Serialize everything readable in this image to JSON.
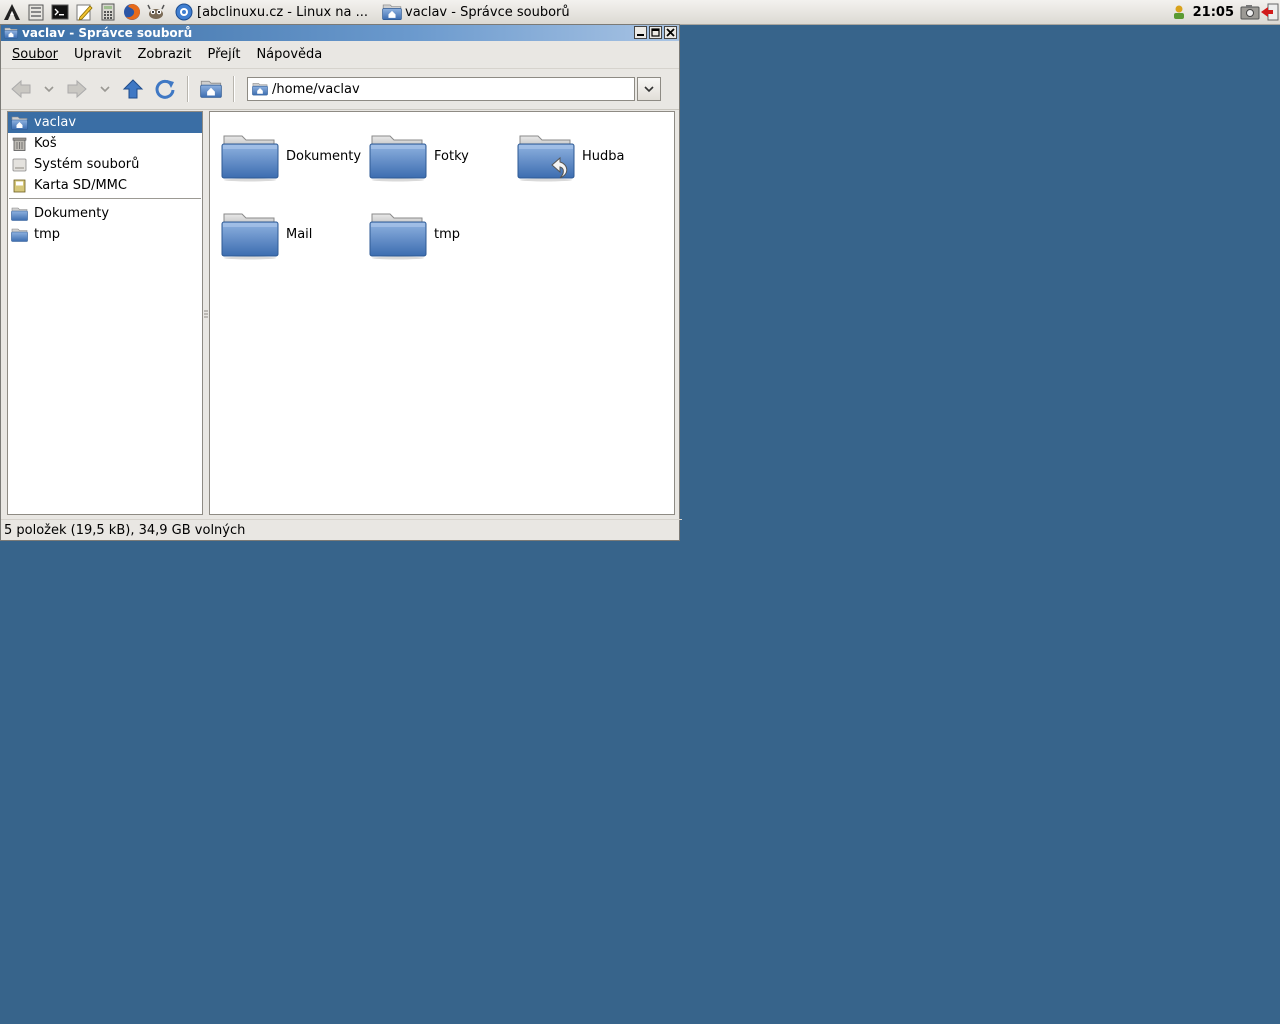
{
  "panel": {
    "launchers": [
      "app-menu-icon",
      "file-manager-icon",
      "terminal-icon",
      "text-editor-icon",
      "calculator-icon",
      "firefox-icon",
      "gimp-icon"
    ],
    "tasks": [
      {
        "label": "[abclinuxu.cz - Linux na ...",
        "icon": "browser-icon"
      },
      {
        "label": "vaclav - Správce souborů",
        "icon": "home-folder-icon"
      }
    ],
    "clock": "21:05"
  },
  "window": {
    "title": "vaclav - Správce souborů",
    "menu": [
      "Soubor",
      "Upravit",
      "Zobrazit",
      "Přejít",
      "Nápověda"
    ],
    "location": "/home/vaclav",
    "sidebar": {
      "places": [
        {
          "label": "vaclav",
          "icon": "home-folder-icon",
          "selected": true
        },
        {
          "label": "Koš",
          "icon": "trash-icon"
        },
        {
          "label": "Systém souborů",
          "icon": "drive-icon"
        },
        {
          "label": "Karta SD/MMC",
          "icon": "sd-card-icon"
        }
      ],
      "bookmarks": [
        {
          "label": "Dokumenty",
          "icon": "folder-icon"
        },
        {
          "label": "tmp",
          "icon": "folder-icon"
        }
      ]
    },
    "files": [
      {
        "name": "Dokumenty",
        "icon": "folder-icon"
      },
      {
        "name": "Fotky",
        "icon": "folder-icon"
      },
      {
        "name": "Hudba",
        "icon": "folder-link-icon"
      },
      {
        "name": "Mail",
        "icon": "folder-icon"
      },
      {
        "name": "tmp",
        "icon": "folder-icon"
      }
    ],
    "status": "5 položek (19,5 kB), 34,9 GB volných"
  },
  "colors": {
    "desktop": "#37648b",
    "selection": "#3a6ea5",
    "titlebar": "#3a6ea5"
  }
}
